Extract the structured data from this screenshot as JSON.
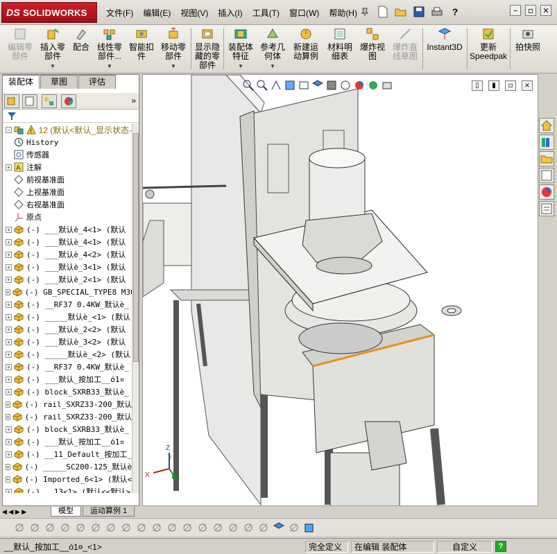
{
  "app": {
    "brand": "SOLIDWORKS",
    "brand_mark": "DS"
  },
  "menu": [
    "文件(F)",
    "编辑(E)",
    "视图(V)",
    "插入(I)",
    "工具(T)",
    "窗口(W)",
    "帮助(H)"
  ],
  "ribbon": [
    {
      "label": "编辑零\n部件",
      "disabled": true,
      "icon": "edit-component-icon"
    },
    {
      "label": "插入零\n部件",
      "disabled": false,
      "icon": "insert-component-icon"
    },
    {
      "label": "配合",
      "disabled": false,
      "icon": "mate-icon"
    },
    {
      "label": "线性零\n部件...",
      "disabled": false,
      "icon": "linear-pattern-icon"
    },
    {
      "label": "智能扣\n件",
      "disabled": false,
      "icon": "smart-fastener-icon"
    },
    {
      "label": "移动零\n部件",
      "disabled": false,
      "icon": "move-component-icon"
    },
    {
      "label": "显示隐\n藏的零\n部件",
      "disabled": false,
      "icon": "show-hidden-icon"
    },
    {
      "label": "装配体\n特征",
      "disabled": false,
      "icon": "assembly-feature-icon"
    },
    {
      "label": "参考几\n何体",
      "disabled": false,
      "icon": "reference-geometry-icon"
    },
    {
      "label": "新建运\n动算例",
      "disabled": false,
      "icon": "new-motion-study-icon"
    },
    {
      "label": "材料明\n细表",
      "disabled": false,
      "icon": "bom-icon"
    },
    {
      "label": "爆炸视\n图",
      "disabled": false,
      "icon": "exploded-view-icon"
    },
    {
      "label": "爆炸直\n线草图",
      "disabled": true,
      "icon": "explode-line-sketch-icon"
    },
    {
      "label": "Instant3D",
      "disabled": false,
      "icon": "instant3d-icon"
    },
    {
      "label": "更新\nSpeedpak",
      "disabled": false,
      "icon": "speedpak-icon"
    },
    {
      "label": "拍快照",
      "disabled": false,
      "icon": "snapshot-icon"
    }
  ],
  "panel_tabs": [
    "装配体",
    "草图",
    "评估"
  ],
  "tree": {
    "root": "12  (默认<默认_显示状态-",
    "items": [
      {
        "label": "History",
        "expandable": false,
        "kind": "history"
      },
      {
        "label": "传感器",
        "expandable": false,
        "kind": "sensor"
      },
      {
        "label": "注解",
        "expandable": true,
        "kind": "annotation"
      },
      {
        "label": "前视基准面",
        "expandable": false,
        "kind": "plane"
      },
      {
        "label": "上视基准面",
        "expandable": false,
        "kind": "plane"
      },
      {
        "label": "右视基准面",
        "expandable": false,
        "kind": "plane"
      },
      {
        "label": "原点",
        "expandable": false,
        "kind": "origin"
      },
      {
        "label": "(-) ___默认è_4<1> (默认",
        "expandable": true,
        "kind": "part"
      },
      {
        "label": "(-) ___默认è_4<1> (默认",
        "expandable": true,
        "kind": "part"
      },
      {
        "label": "(-) ___默认è_4<2> (默认",
        "expandable": true,
        "kind": "part"
      },
      {
        "label": "(-) ___默认è_3<1> (默认",
        "expandable": true,
        "kind": "part"
      },
      {
        "label": "(-) ___默认è_2<1> (默认",
        "expandable": true,
        "kind": "part"
      },
      {
        "label": "(-) GB_SPECIAL_TYPE8 M30",
        "expandable": true,
        "kind": "part"
      },
      {
        "label": "(-) __RF37 0.4KW_默认è_",
        "expandable": true,
        "kind": "part"
      },
      {
        "label": "(-) _____默认è_<1> (默认",
        "expandable": true,
        "kind": "part"
      },
      {
        "label": "(-) ___默认è_2<2> (默认",
        "expandable": true,
        "kind": "part"
      },
      {
        "label": "(-) ___默认è_3<2> (默认",
        "expandable": true,
        "kind": "part"
      },
      {
        "label": "(-) _____默认è_<2> (默认",
        "expandable": true,
        "kind": "part"
      },
      {
        "label": "(-) __RF37 0.4KW_默认è_",
        "expandable": true,
        "kind": "part"
      },
      {
        "label": "(-) ___默认_按加工__ó1¤",
        "expandable": true,
        "kind": "part"
      },
      {
        "label": "(-) block_SXRB33_默认è_",
        "expandable": true,
        "kind": "part"
      },
      {
        "label": "(-) rail_SXRZ33-200_默认",
        "expandable": true,
        "kind": "part"
      },
      {
        "label": "(-) rail_SXRZ33-200_默认",
        "expandable": true,
        "kind": "part"
      },
      {
        "label": "(-) block_SXRB33_默认è_",
        "expandable": true,
        "kind": "part"
      },
      {
        "label": "(-) ___默认_按加工__ó1¤",
        "expandable": true,
        "kind": "part"
      },
      {
        "label": "(-) __11_Default_按加工_",
        "expandable": true,
        "kind": "part"
      },
      {
        "label": "(-) _____SC200-125_默认è",
        "expandable": true,
        "kind": "part"
      },
      {
        "label": "(-) Imported_6<1> (默认<",
        "expandable": true,
        "kind": "part"
      },
      {
        "label": "(-) __13<1> (默认<<默认>",
        "expandable": true,
        "kind": "part"
      }
    ]
  },
  "bottom_tabs": [
    "模型",
    "运动算例 1"
  ],
  "status": {
    "selection": "__默认_按加工__ó1¤_<1>",
    "state": "完全定义",
    "mode": "在编辑 装配体",
    "units": "自定义",
    "help": "?"
  },
  "triad": {
    "x": "X",
    "y": "Y",
    "z": "Z"
  },
  "colors": {
    "brand_red": "#c8102e",
    "accent_orange": "#e8901a"
  }
}
